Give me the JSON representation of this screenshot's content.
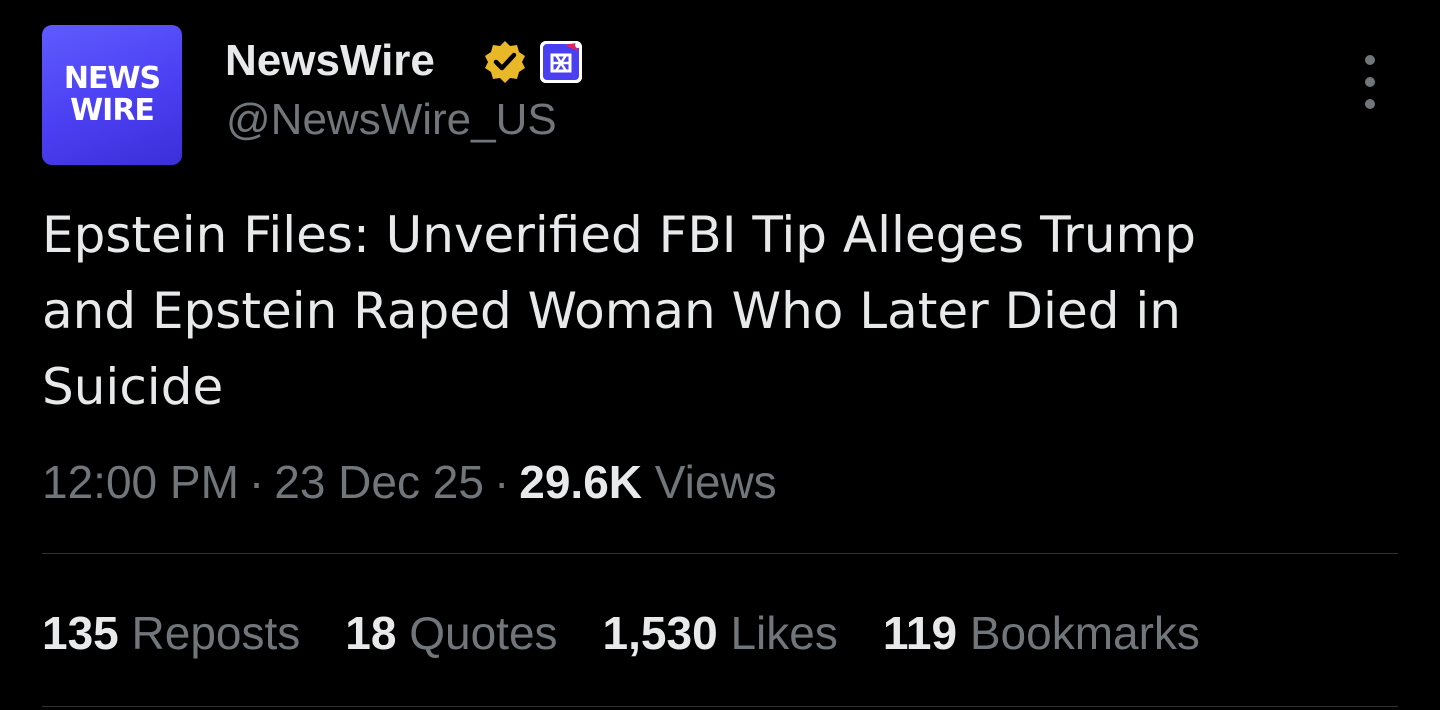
{
  "account": {
    "avatar_text_line1": "NEWS",
    "avatar_text_line2": "WIRE",
    "display_name": "NewsWire",
    "handle": "@NewsWire_US",
    "verified_badge_color": "#e8b829",
    "avatar_color": "#4b3ff2"
  },
  "tweet": {
    "text": "Epstein Files: Unverified FBI Tip Alleges Trump\nand Epstein Raped Woman Who Later Died in\nSuicide",
    "time": "12:00 PM",
    "separator": "·",
    "date": "23 Dec 25",
    "views_count": "29.6K",
    "views_label": "Views"
  },
  "stats": {
    "reposts_count": "135",
    "reposts_label": "Reposts",
    "quotes_count": "18",
    "quotes_label": "Quotes",
    "likes_count": "1,530",
    "likes_label": "Likes",
    "bookmarks_count": "119",
    "bookmarks_label": "Bookmarks"
  },
  "icons": {
    "more": "more-vertical-icon",
    "verified": "verified-badge-icon",
    "affiliate": "affiliate-badge-icon"
  },
  "colors": {
    "background": "#000000",
    "primary_text": "#e7e9ea",
    "secondary_text": "#71767b",
    "divider": "#2f3336"
  }
}
